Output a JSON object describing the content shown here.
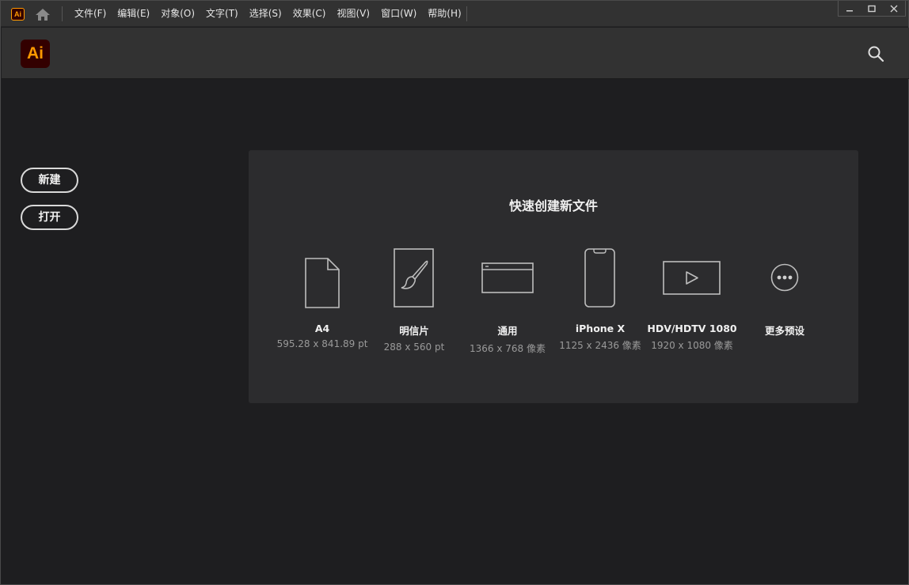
{
  "menubar": {
    "app_badge": "Ai",
    "items": [
      {
        "label": "文件(F)"
      },
      {
        "label": "编辑(E)"
      },
      {
        "label": "对象(O)"
      },
      {
        "label": "文字(T)"
      },
      {
        "label": "选择(S)"
      },
      {
        "label": "效果(C)"
      },
      {
        "label": "视图(V)"
      },
      {
        "label": "窗口(W)"
      },
      {
        "label": "帮助(H)"
      }
    ]
  },
  "header": {
    "logo": "Ai"
  },
  "sidebar": {
    "new_label": "新建",
    "open_label": "打开"
  },
  "quick_create": {
    "title": "快速创建新文件",
    "presets": [
      {
        "name": "A4",
        "dims": "595.28 x 841.89 pt",
        "icon": "document-icon"
      },
      {
        "name": "明信片",
        "dims": "288 x 560 pt",
        "icon": "brush-icon"
      },
      {
        "name": "通用",
        "dims": "1366 x 768 像素",
        "icon": "browser-window-icon"
      },
      {
        "name": "iPhone X",
        "dims": "1125 x 2436 像素",
        "icon": "phone-icon"
      },
      {
        "name": "HDV/HDTV 1080",
        "dims": "1920 x 1080 像素",
        "icon": "video-play-icon"
      },
      {
        "name": "更多预设",
        "dims": "",
        "icon": "more-icon"
      }
    ]
  },
  "colors": {
    "accent": "#ff9a00",
    "logo_bg": "#330000",
    "background": "#1e1e20",
    "panel": "#2c2c2e",
    "bar": "#323232"
  }
}
